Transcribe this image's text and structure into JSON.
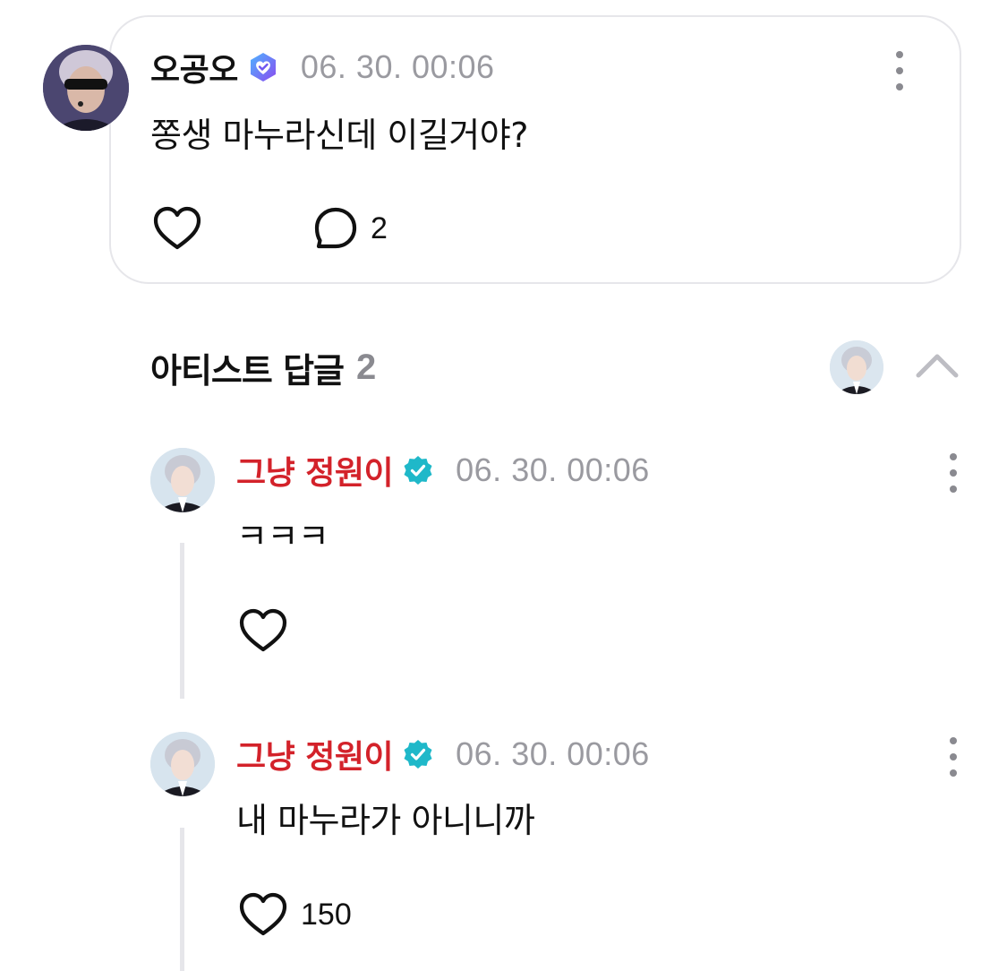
{
  "post": {
    "author": "오공오",
    "timestamp": "06. 30. 00:06",
    "body": "쫑생 마누라신데 이길거야?",
    "comment_count": "2",
    "badge_color": "#6f56f0"
  },
  "replies_section": {
    "title": "아티스트 답글",
    "count": "2"
  },
  "replies": [
    {
      "author": "그냥 정원이",
      "timestamp": "06. 30. 00:06",
      "body": "ㅋㅋㅋ",
      "like_count": ""
    },
    {
      "author": "그냥 정원이",
      "timestamp": "06. 30. 00:06",
      "body": "내 마누라가 아니니까",
      "like_count": "150"
    }
  ],
  "colors": {
    "artist_name": "#d3222a",
    "verified_badge": "#1fb8c9",
    "muted_text": "#9a9aa0",
    "card_border": "#e6e6ea"
  },
  "icons": {
    "like": "heart-icon",
    "comment": "comment-bubble-icon",
    "more": "vertical-ellipsis-icon",
    "collapse": "chevron-up-icon",
    "fan_badge": "heart-check-badge-icon",
    "artist_badge": "verified-check-badge-icon"
  }
}
